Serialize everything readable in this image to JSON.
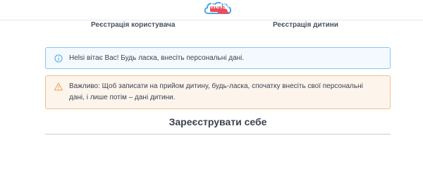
{
  "logo": {
    "text": "helsi"
  },
  "tabs": [
    {
      "label": "Реєстрація користувача"
    },
    {
      "label": "Реєстрація дитини"
    }
  ],
  "info_alert": {
    "text": "Helsi вітає Вас! Будь ласка, внесіть персональні дані.",
    "icon": "info-icon"
  },
  "warning_alert": {
    "line1": "Важливо: Щоб записати на прийом дитину, будь-ласка, спочатку внесіть свої персональні",
    "line2": "дані, і лише потім – дані дитини.",
    "icon": "warning-icon"
  },
  "section": {
    "title": "Зареєструвати себе"
  },
  "colors": {
    "brand_blue": "#4aa8e6",
    "brand_red": "#ee4b5a",
    "info_border": "#8dc5ea",
    "warn_border": "#f3c08a"
  }
}
